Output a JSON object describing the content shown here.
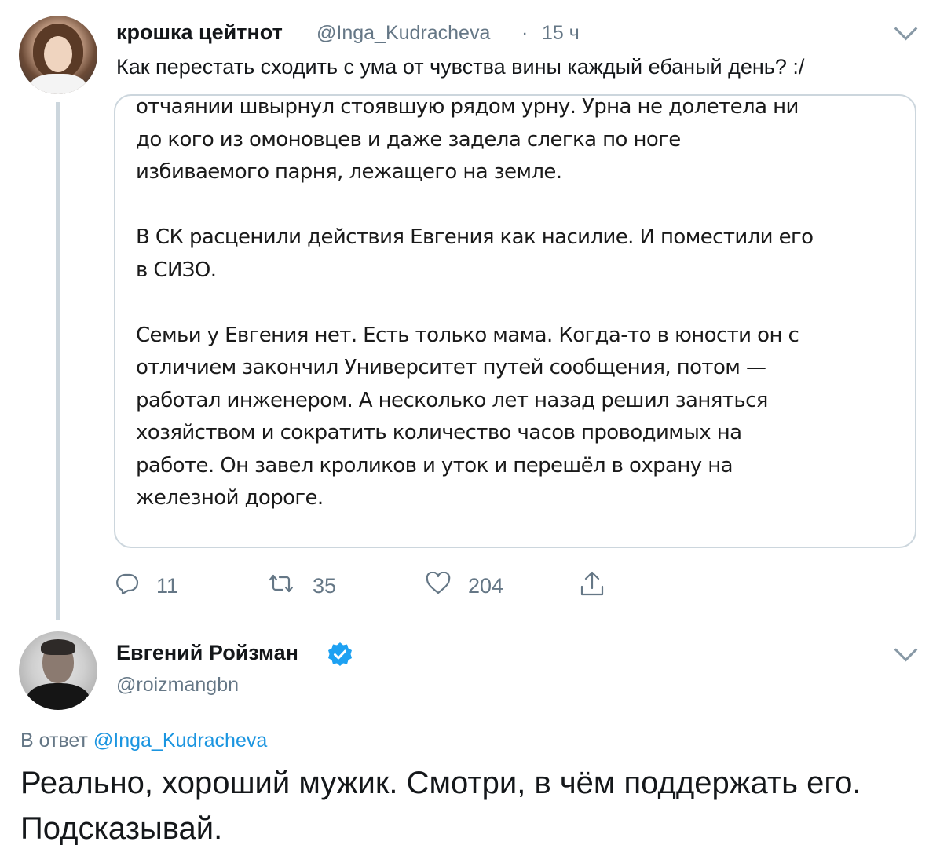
{
  "tweet1": {
    "name": "крошка цейтнот",
    "handle": "@Inga_Kudracheva",
    "separator": "·",
    "time": "15 ч",
    "text": "Как перестать сходить с ума от чувства вины каждый ебаный день? :/",
    "quote_paragraphs": [
      "отчаянии швырнул стоявшую рядом урну. Урна не долетела ни\nдо кого из омоновцев и даже задела слегка по ноге\nизбиваемого парня, лежащего на земле.",
      "В СК расценили действия Евгения как насилие. И поместили его\nв СИЗО.",
      "Семьи у Евгения нет. Есть только мама. Когда-то в юности он с\nотличием закончил Университет путей сообщения, потом —\nработал инженером. А несколько лет назад решил заняться\nхозяйством и сократить количество часов проводимых на\nработе. Он завел  кроликов и уток и перешёл в охрану на\nжелезной дороге."
    ],
    "actions": {
      "reply_count": "11",
      "retweet_count": "35",
      "like_count": "204"
    }
  },
  "tweet2": {
    "name": "Евгений Ройзман",
    "handle": "@roizmangbn",
    "reply_prefix": "В ответ",
    "reply_mention": "@Inga_Kudracheva",
    "text": "Реально, хороший мужик. Смотри, в чём поддержать его. Подсказывай."
  },
  "colors": {
    "text": "#14171a",
    "secondary": "#657786",
    "link": "#1b95e0",
    "border": "#ccd6dd",
    "verified": "#1da1f2"
  },
  "icons": [
    "chevron-down-icon",
    "reply-icon",
    "retweet-icon",
    "like-icon",
    "share-icon",
    "verified-badge-icon"
  ]
}
